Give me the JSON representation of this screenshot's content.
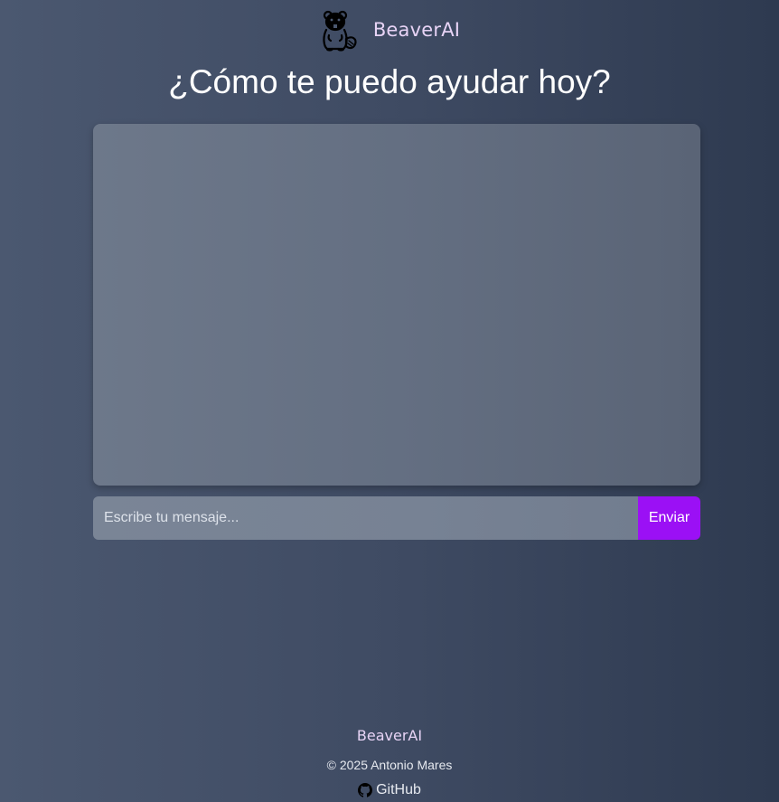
{
  "header": {
    "logo_icon": "beaver-icon",
    "brand": "BeaverAI"
  },
  "main": {
    "title": "¿Cómo te puedo ayudar hoy?"
  },
  "chat": {
    "input_placeholder": "Escribe tu mensaje...",
    "input_value": "",
    "send_label": "Enviar"
  },
  "footer": {
    "brand": "BeaverAI",
    "copyright": "© 2025 Antonio Mares",
    "github_icon": "github-icon",
    "github_label": "GitHub"
  },
  "colors": {
    "accent": "#9b10f5",
    "brand_text": "#e7d3f5"
  }
}
